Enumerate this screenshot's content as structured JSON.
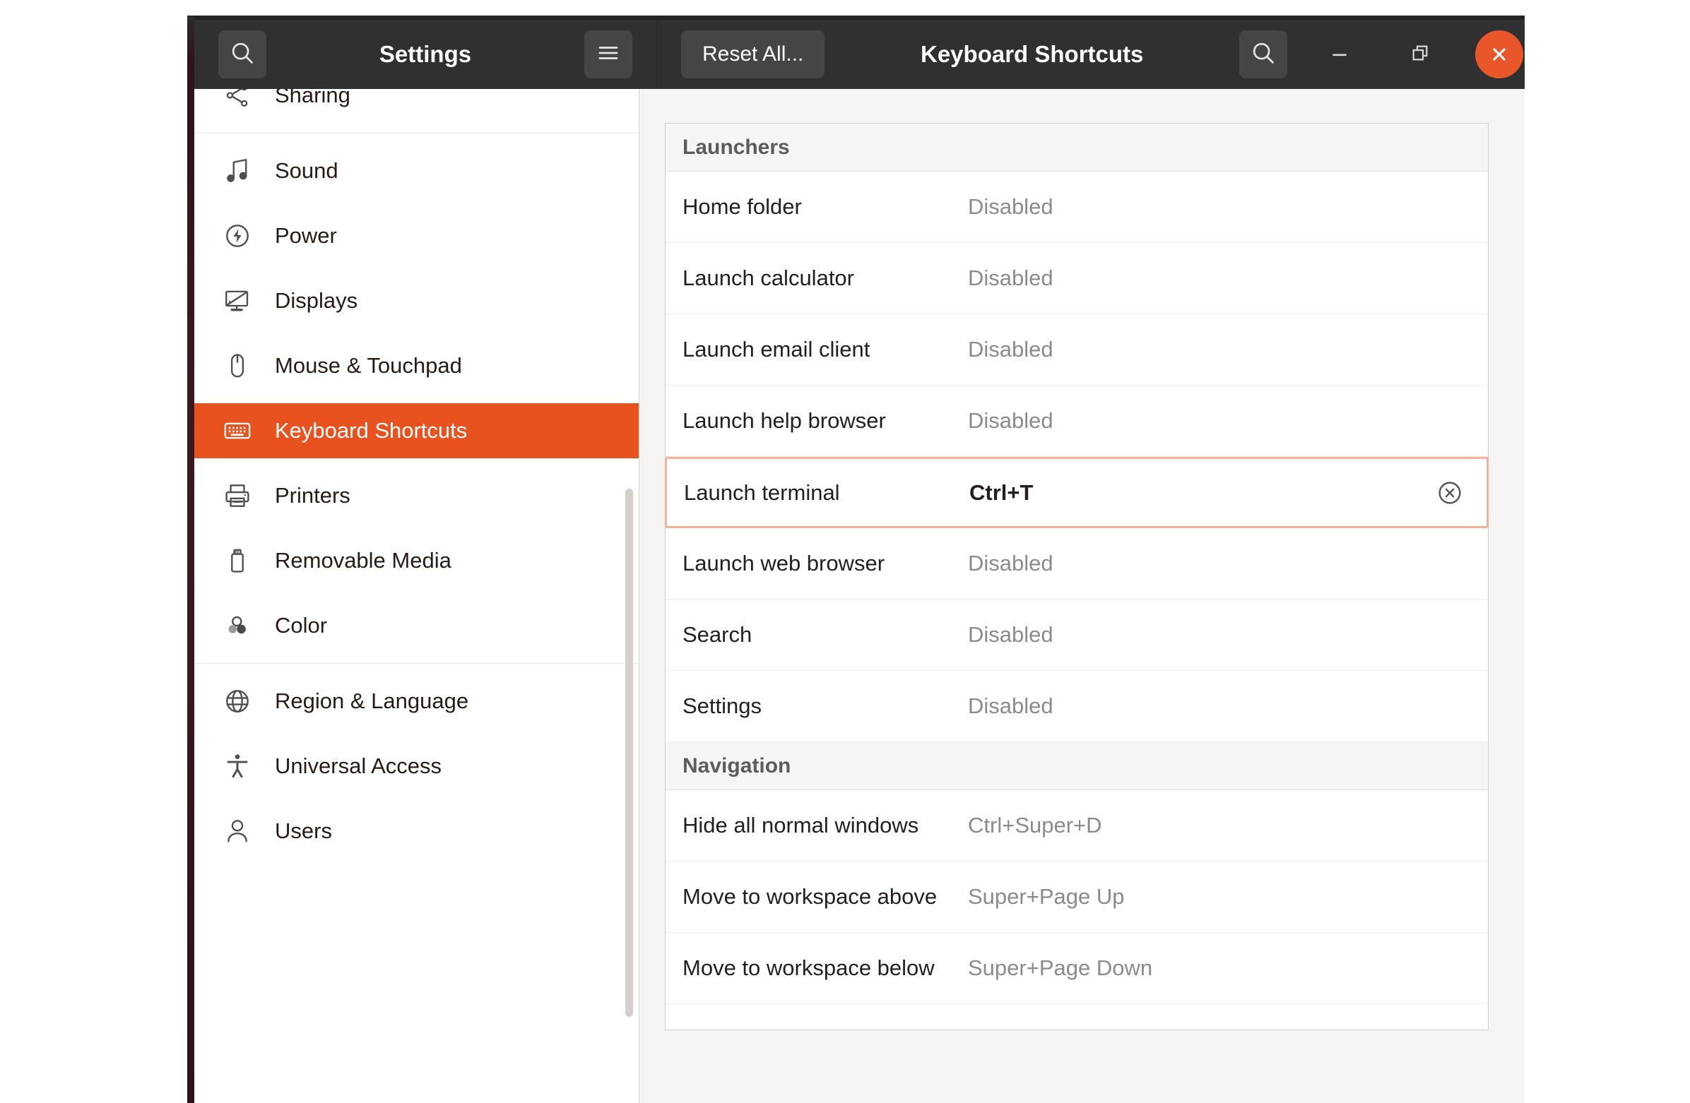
{
  "window": {
    "left_panel_title": "Settings",
    "right_panel_title": "Keyboard Shortcuts",
    "reset_button": "Reset All...",
    "search_icon_left": "search-icon",
    "menu_icon": "hamburger-menu-icon",
    "search_icon_right": "search-icon",
    "minimize_icon": "minimize-icon",
    "maximize_icon": "restore-window-icon",
    "close_icon": "close-icon",
    "accent_color": "#e8521f",
    "headerbar_color": "#303030",
    "focus_border_color": "#f3b19a"
  },
  "sidebar": {
    "items": [
      {
        "label": "Sharing",
        "icon": "share-icon",
        "selected": false,
        "separator_after": true
      },
      {
        "label": "Sound",
        "icon": "music-note-icon",
        "selected": false,
        "separator_after": false
      },
      {
        "label": "Power",
        "icon": "power-bolt-icon",
        "selected": false,
        "separator_after": false
      },
      {
        "label": "Displays",
        "icon": "display-monitor-icon",
        "selected": false,
        "separator_after": false
      },
      {
        "label": "Mouse & Touchpad",
        "icon": "mouse-icon",
        "selected": false,
        "separator_after": false
      },
      {
        "label": "Keyboard Shortcuts",
        "icon": "keyboard-icon",
        "selected": true,
        "separator_after": false
      },
      {
        "label": "Printers",
        "icon": "printer-icon",
        "selected": false,
        "separator_after": false
      },
      {
        "label": "Removable Media",
        "icon": "usb-drive-icon",
        "selected": false,
        "separator_after": false
      },
      {
        "label": "Color",
        "icon": "color-circles-icon",
        "selected": false,
        "separator_after": true
      },
      {
        "label": "Region & Language",
        "icon": "globe-icon",
        "selected": false,
        "separator_after": false
      },
      {
        "label": "Universal Access",
        "icon": "accessibility-icon",
        "selected": false,
        "separator_after": false
      },
      {
        "label": "Users",
        "icon": "person-icon",
        "selected": false,
        "separator_after": false
      }
    ]
  },
  "content": {
    "sections": [
      {
        "title": "Launchers",
        "rows": [
          {
            "name": "Home folder",
            "accel": "Disabled",
            "focused": false
          },
          {
            "name": "Launch calculator",
            "accel": "Disabled",
            "focused": false
          },
          {
            "name": "Launch email client",
            "accel": "Disabled",
            "focused": false
          },
          {
            "name": "Launch help browser",
            "accel": "Disabled",
            "focused": false
          },
          {
            "name": "Launch terminal",
            "accel": "Ctrl+T",
            "focused": true
          },
          {
            "name": "Launch web browser",
            "accel": "Disabled",
            "focused": false
          },
          {
            "name": "Search",
            "accel": "Disabled",
            "focused": false
          },
          {
            "name": "Settings",
            "accel": "Disabled",
            "focused": false
          }
        ]
      },
      {
        "title": "Navigation",
        "rows": [
          {
            "name": "Hide all normal windows",
            "accel": "Ctrl+Super+D",
            "focused": false
          },
          {
            "name": "Move to workspace above",
            "accel": "Super+Page Up",
            "focused": false
          },
          {
            "name": "Move to workspace below",
            "accel": "Super+Page Down",
            "focused": false
          }
        ]
      }
    ]
  }
}
